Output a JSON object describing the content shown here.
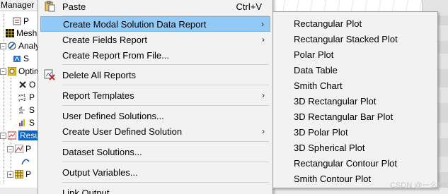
{
  "background": {
    "tree_header": "Manager",
    "tree_items": [
      {
        "label": "P",
        "icon": "report-icon"
      },
      {
        "label": "Mesh",
        "icon": "mesh-icon"
      },
      {
        "label": "Analy",
        "icon": "analysis-icon"
      },
      {
        "label": "S",
        "icon": "setup-icon"
      },
      {
        "label": "Optim",
        "icon": "optimetrics-icon"
      },
      {
        "label": "O",
        "icon": "optimization-icon"
      },
      {
        "label": "P",
        "icon": "parametric-icon"
      },
      {
        "label": "S",
        "icon": "sensitivity-icon"
      },
      {
        "label": "S",
        "icon": "statistical-icon"
      },
      {
        "label": "Resu",
        "icon": "results-icon"
      },
      {
        "label": "P",
        "icon": "plot-icon"
      },
      {
        "label": "",
        "icon": "sub-icon"
      },
      {
        "label": "P",
        "icon": "table-icon"
      }
    ]
  },
  "context_menu": {
    "items": [
      {
        "label": "Paste",
        "shortcut": "Ctrl+V",
        "icon": "paste-icon"
      },
      {
        "label": "Create Modal Solution Data Report",
        "submenu": true,
        "highlighted": true
      },
      {
        "label": "Create Fields Report",
        "submenu": true
      },
      {
        "label": "Create Report From File..."
      },
      {
        "label": "Delete All Reports",
        "icon": "delete-reports-icon"
      },
      {
        "label": "Report Templates",
        "submenu": true
      },
      {
        "label": "User Defined Solutions..."
      },
      {
        "label": "Create User Defined Solution",
        "submenu": true
      },
      {
        "label": "Dataset Solutions..."
      },
      {
        "label": "Output Variables..."
      },
      {
        "label": "Link Output"
      }
    ],
    "submenu_arrow": "›"
  },
  "submenu": {
    "items": [
      "Rectangular Plot",
      "Rectangular Stacked Plot",
      "Polar Plot",
      "Data Table",
      "Smith Chart",
      "3D Rectangular Plot",
      "3D Rectangular Bar Plot",
      "3D Polar Plot",
      "3D Spherical Plot",
      "Rectangular Contour Plot",
      "Smith Contour Plot"
    ]
  },
  "watermark": "CSDN @一么993",
  "colors": {
    "menu_bg": "#f2f2f2",
    "highlight_bg": "#91c9f7",
    "selected_tree_bg": "#0a64c8"
  }
}
